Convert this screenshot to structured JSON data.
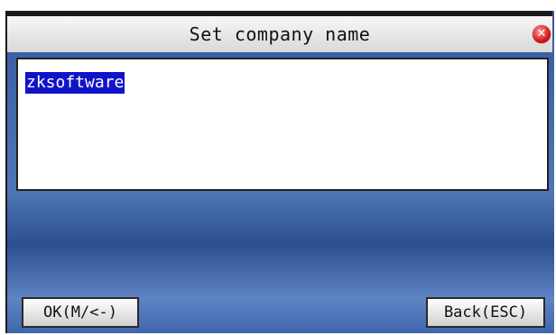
{
  "dialog": {
    "title": "Set company name",
    "close_icon": "close-icon"
  },
  "input": {
    "value": "zksoftware"
  },
  "buttons": {
    "ok_label": "OK(M/<-)",
    "back_label": "Back(ESC)"
  },
  "colors": {
    "selection": "#1014c8",
    "background": "#35599f",
    "close": "#d41818"
  }
}
